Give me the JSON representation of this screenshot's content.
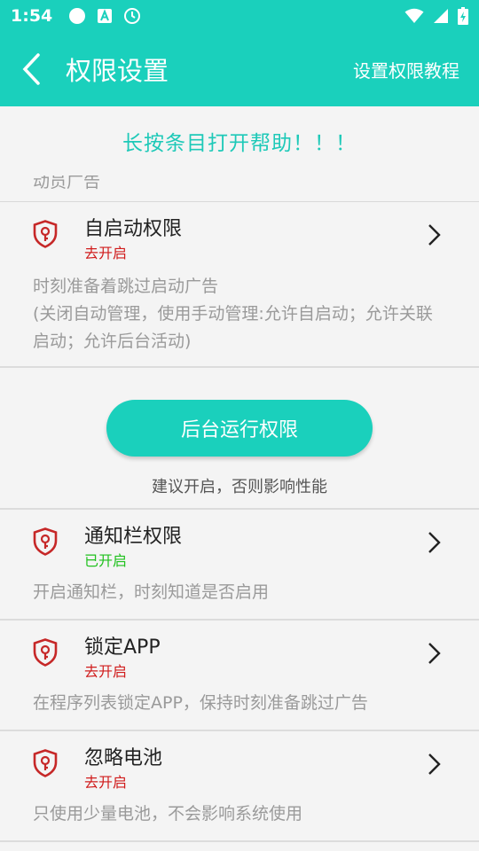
{
  "status_bar": {
    "time": "1:54",
    "icons": [
      "circle-icon",
      "a-box-icon",
      "clock-icon",
      "wifi-icon",
      "signal-icon",
      "battery-icon"
    ]
  },
  "app_bar": {
    "title": "权限设置",
    "action": "设置权限教程"
  },
  "hint": "长按条目打开帮助！！！",
  "cut_row_text": "动员广告",
  "items": [
    {
      "title": "自启动权限",
      "status": "去开启",
      "enabled": false,
      "desc": "时刻准备着跳过启动广告\n(关闭自动管理，使用手动管理:允许自启动；允许关联启动；允许后台活动)"
    },
    {
      "title": "通知栏权限",
      "status": "已开启",
      "enabled": true,
      "desc": "开启通知栏，时刻知道是否启用"
    },
    {
      "title": "锁定APP",
      "status": "去开启",
      "enabled": false,
      "desc": "在程序列表锁定APP，保持时刻准备跳过广告"
    },
    {
      "title": "忽略电池",
      "status": "去开启",
      "enabled": false,
      "desc": "只使用少量电池，不会影响系统使用"
    }
  ],
  "background_section": {
    "button_label": "后台运行权限",
    "note": "建议开启，否则影响性能"
  },
  "colors": {
    "accent": "#1ad0bc",
    "status_off": "#d01c1c",
    "status_on": "#20c11e",
    "shield": "#c62828"
  }
}
